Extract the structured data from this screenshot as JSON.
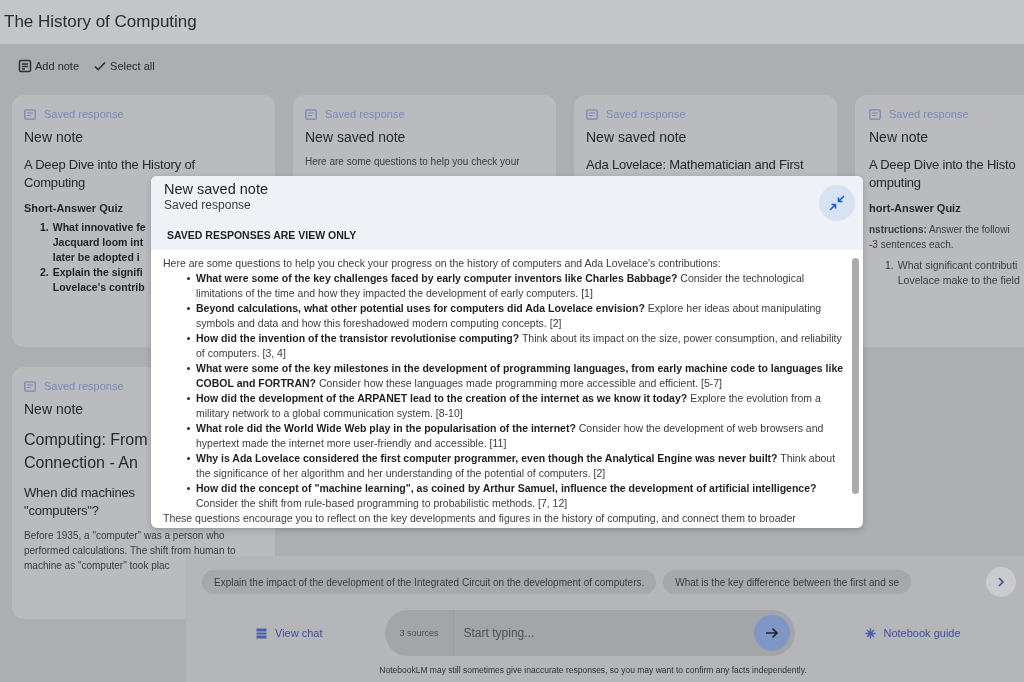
{
  "header": {
    "title": "The History of Computing"
  },
  "toolbar": [
    {
      "kind": "add",
      "label": "Add note"
    },
    {
      "kind": "select",
      "label": "Select all"
    }
  ],
  "notes": [
    {
      "tag": "Saved response",
      "title": "New note",
      "blocks": [
        {
          "kind": "heading",
          "lines": [
            "A Deep Dive into the History of",
            "Computing"
          ]
        },
        {
          "kind": "subheading",
          "lines": [
            "Short-Answer Quiz"
          ]
        },
        {
          "kind": "item",
          "number": "1.",
          "bold": true,
          "lines": [
            "What innovative fe",
            "Jacquard loom int",
            "later be adopted i"
          ]
        },
        {
          "kind": "item",
          "number": "2.",
          "bold": true,
          "lines": [
            "Explain the signifi",
            "Lovelace's contrib"
          ]
        }
      ]
    },
    {
      "tag": "Saved response",
      "title": "New saved note",
      "blocks": [
        {
          "kind": "text",
          "lines": [
            "Here are some questions to help you check your"
          ]
        }
      ]
    },
    {
      "tag": "Saved response",
      "title": "New saved note",
      "blocks": [
        {
          "kind": "heading",
          "lines": [
            "Ada Lovelace: Mathematician and First"
          ]
        }
      ]
    },
    {
      "tag": "Saved response",
      "title": "New note",
      "blocks": [
        {
          "kind": "heading",
          "lines": [
            "A Deep Dive into the Histo",
            "omputing"
          ]
        },
        {
          "kind": "subheading",
          "lines": [
            "hort-Answer Quiz"
          ]
        },
        {
          "kind": "text",
          "lines": [
            "**nstructions:** Answer the followi",
            "-3 sentences each."
          ]
        },
        {
          "kind": "item",
          "number": "1.",
          "bold": false,
          "lines": [
            "What significant contributi",
            "Lovelace make to the field"
          ]
        }
      ]
    },
    {
      "tag": "Saved response",
      "title": "New note",
      "blocks": [
        {
          "kind": "display",
          "lines": [
            "Computing: From",
            "Connection - An"
          ]
        },
        {
          "kind": "heading",
          "lines": [
            "When did machines",
            "\"computers\"?"
          ]
        },
        {
          "kind": "text",
          "lines": [
            "Before 1935, a \"computer\" was a person who",
            "performed calculations. The shift from human to",
            "machine as \"computer\" took plac"
          ]
        }
      ]
    }
  ],
  "modal": {
    "title": "New saved note",
    "subtitle": "Saved response",
    "notice": "SAVED RESPONSES ARE VIEW ONLY",
    "intro": "Here are some questions to help you check your progress on the history of computers and Ada Lovelace's contributions:",
    "items": [
      "**What were some of the key challenges faced by early computer inventors like Charles Babbage?** Consider the technological limitations of the time and how they impacted the development of early computers. [1]",
      "**Beyond calculations, what other potential uses for computers did Ada Lovelace envision?** Explore her ideas about manipulating symbols and data and how this foreshadowed modern computing concepts. [2]",
      "**How did the invention of the transistor revolutionise computing?** Think about its impact on the size, power consumption, and reliability of computers. [3, 4]",
      "**What were some of the key milestones in the development of programming languages, from early machine code to languages like COBOL and FORTRAN?** Consider how these languages made programming more accessible and efficient. [5-7]",
      "**How did the development of the ARPANET lead to the creation of the internet as we know it today?** Explore the evolution from a military network to a global communication system. [8-10]",
      "**What role did the World Wide Web play in the popularisation of the internet?** Consider how the development of web browsers and hypertext made the internet more user-friendly and accessible. [11]",
      "**Why is Ada Lovelace considered the first computer programmer, even though the Analytical Engine was never built?** Think about the significance of her algorithm and her understanding of the potential of computers. [2]",
      "**How did the concept of \"machine learning\", as coined by Arthur Samuel, influence the development of artificial intelligence?** Consider the shift from rule-based programming to probabilistic methods. [7, 12]"
    ],
    "closing": "These questions encourage you to reflect on the key developments and figures in the history of computing, and connect them to broader"
  },
  "suggestions": [
    "Explain the impact of the development of the Integrated Circuit on the development of computers.",
    "What is the key difference between the first and se"
  ],
  "chat": {
    "view_chat": "View chat",
    "sources": "3 sources",
    "placeholder": "Start typing...",
    "guide": "Notebook guide"
  },
  "disclaimer": "NotebookLM may still sometimes give inaccurate responses, so you may want to confirm any facts independently."
}
